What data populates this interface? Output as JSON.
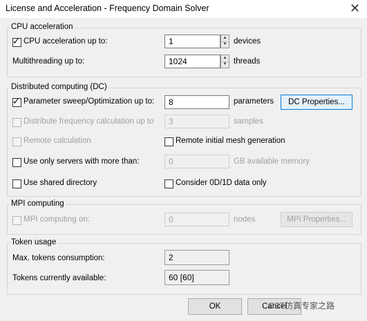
{
  "window": {
    "title": "License and Acceleration - Frequency Domain Solver",
    "close_glyph": "✕"
  },
  "cpu": {
    "group_label": "CPU acceleration",
    "accel_label": "CPU acceleration up to:",
    "accel_checked": true,
    "accel_value": "1",
    "accel_unit": "devices",
    "mt_label": "Multithreading up to:",
    "mt_value": "1024",
    "mt_unit": "threads"
  },
  "dc": {
    "group_label": "Distributed computing (DC)",
    "sweep_label": "Parameter sweep/Optimization up to:",
    "sweep_checked": true,
    "sweep_value": "8",
    "sweep_unit": "parameters",
    "dc_props_button": "DC Properties...",
    "freq_label": "Distribute frequency calculation up to",
    "freq_value": "3",
    "freq_unit": "samples",
    "remote_label": "Remote calculation",
    "remote_mesh_label": "Remote initial mesh generation",
    "servers_label": "Use only servers with more than:",
    "servers_value": "0",
    "servers_unit": "GB available memory",
    "shared_dir_label": "Use shared directory",
    "consider_label": "Consider 0D/1D data only"
  },
  "mpi": {
    "group_label": "MPI computing",
    "mpi_label": "MPI computing on:",
    "mpi_value": "0",
    "mpi_unit": "nodes",
    "mpi_props_button": "MPI Properties..."
  },
  "token": {
    "group_label": "Token usage",
    "max_label": "Max. tokens consumption:",
    "max_value": "2",
    "avail_label": "Tokens currently available:",
    "avail_value": "60 [60]"
  },
  "buttons": {
    "ok": "OK",
    "cancel": "Cancel"
  },
  "check_glyph": "✓",
  "spin_up_glyph": "▲",
  "spin_down_glyph": "▼",
  "watermark": "CST仿真专家之路"
}
